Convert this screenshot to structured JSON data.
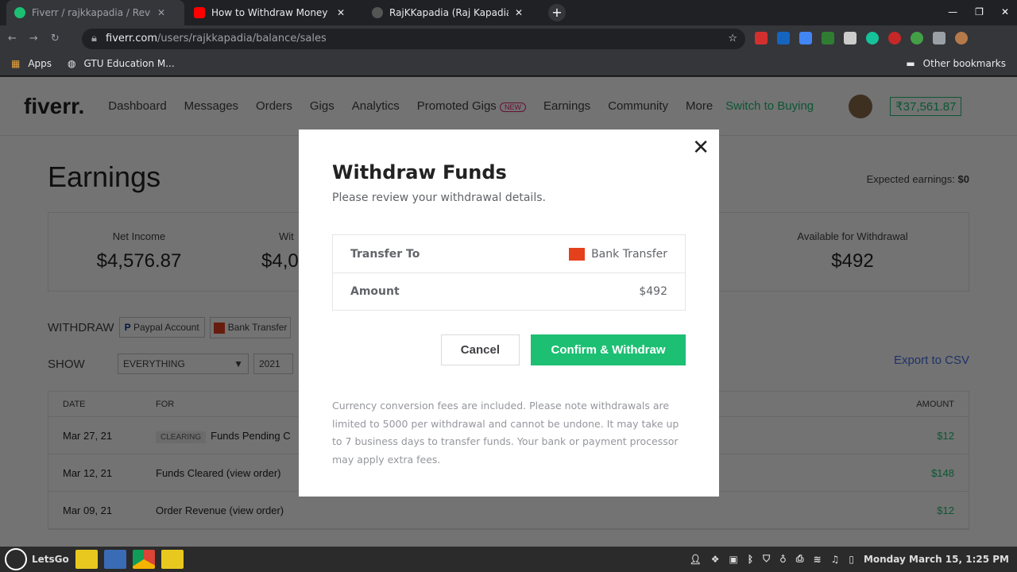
{
  "browser": {
    "tabs": [
      {
        "title": "Fiverr / rajkkapadia / Revenue",
        "color": "#1dbf73"
      },
      {
        "title": "How to Withdraw Money from",
        "color": "#ff0000"
      },
      {
        "title": "RajKKapadia (Raj Kapadia)",
        "color": "#555"
      }
    ],
    "url_host": "fiverr.com",
    "url_path": "/users/rajkkapadia/balance/sales",
    "bookmarks": [
      "Apps",
      "GTU Education M..."
    ],
    "other_bookmarks": "Other bookmarks"
  },
  "nav": {
    "logo": "fiverr.",
    "items": [
      "Dashboard",
      "Messages",
      "Orders",
      "Gigs",
      "Analytics",
      "Promoted Gigs",
      "Earnings",
      "Community",
      "More"
    ],
    "new_badge": "NEW",
    "switch": "Switch to Buying",
    "balance": "₹37,561.87"
  },
  "page": {
    "title": "Earnings",
    "expected_label": "Expected earnings:",
    "expected_value": "$0",
    "stats": [
      {
        "label": "Net Income",
        "value": "$4,576.87"
      },
      {
        "label": "Wit",
        "value": "$4,0"
      },
      {
        "label": "",
        "value": ""
      },
      {
        "label": "Available for Withdrawal",
        "value": "$492"
      }
    ],
    "withdraw_label": "WITHDRAW",
    "paypal": "Paypal Account",
    "bank": "Bank Transfer",
    "show_label": "SHOW",
    "filter": "EVERYTHING",
    "year": "2021",
    "export": "Export to CSV",
    "table": {
      "headers": [
        "DATE",
        "FOR",
        "AMOUNT"
      ],
      "clearing": "CLEARING",
      "rows": [
        [
          "Mar 27, 21",
          "Funds Pending C",
          "$12"
        ],
        [
          "Mar 12, 21",
          "Funds Cleared (view order)",
          "$148"
        ],
        [
          "Mar 09, 21",
          "Order Revenue (view order)",
          "$12"
        ]
      ]
    }
  },
  "modal": {
    "title": "Withdraw Funds",
    "subtitle": "Please review your withdrawal details.",
    "transfer_label": "Transfer To",
    "transfer_value": "Bank Transfer",
    "amount_label": "Amount",
    "amount_value": "$492",
    "cancel": "Cancel",
    "confirm": "Confirm & Withdraw",
    "note": "Currency conversion fees are included. Please note withdrawals are limited to 5000 per withdrawal and cannot be undone. It may take up to 7 business days to transfer funds. Your bank or payment processor may apply extra fees."
  },
  "taskbar": {
    "start": "LetsGo",
    "clock": "Monday March 15, 1:25 PM"
  }
}
